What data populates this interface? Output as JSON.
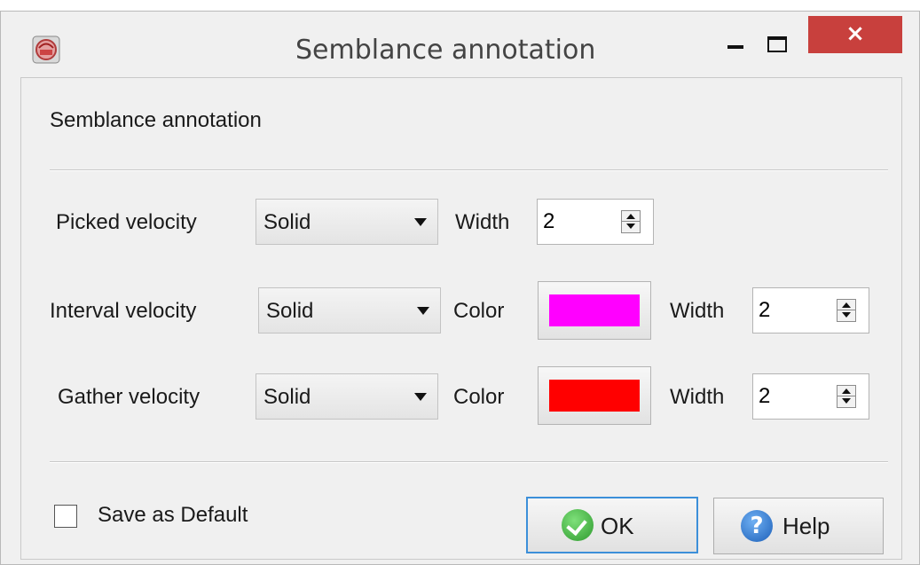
{
  "window": {
    "title": "Semblance annotation",
    "close_glyph": "×"
  },
  "section_title": "Semblance annotation",
  "rows": {
    "picked": {
      "label": "Picked velocity",
      "style": "Solid",
      "width_label": "Width",
      "width": "2"
    },
    "interval": {
      "label": "Interval velocity",
      "style": "Solid",
      "color_label": "Color",
      "color": "#ff00ff",
      "width_label": "Width",
      "width": "2"
    },
    "gather": {
      "label": "Gather velocity",
      "style": "Solid",
      "color_label": "Color",
      "color": "#ff0000",
      "width_label": "Width",
      "width": "2"
    }
  },
  "save_default": {
    "label": "Save as Default",
    "checked": false
  },
  "buttons": {
    "ok": "OK",
    "help": "Help",
    "help_glyph": "?"
  },
  "icons": {
    "app": "app-icon",
    "ok": "check-circle-icon",
    "help": "question-circle-icon"
  }
}
